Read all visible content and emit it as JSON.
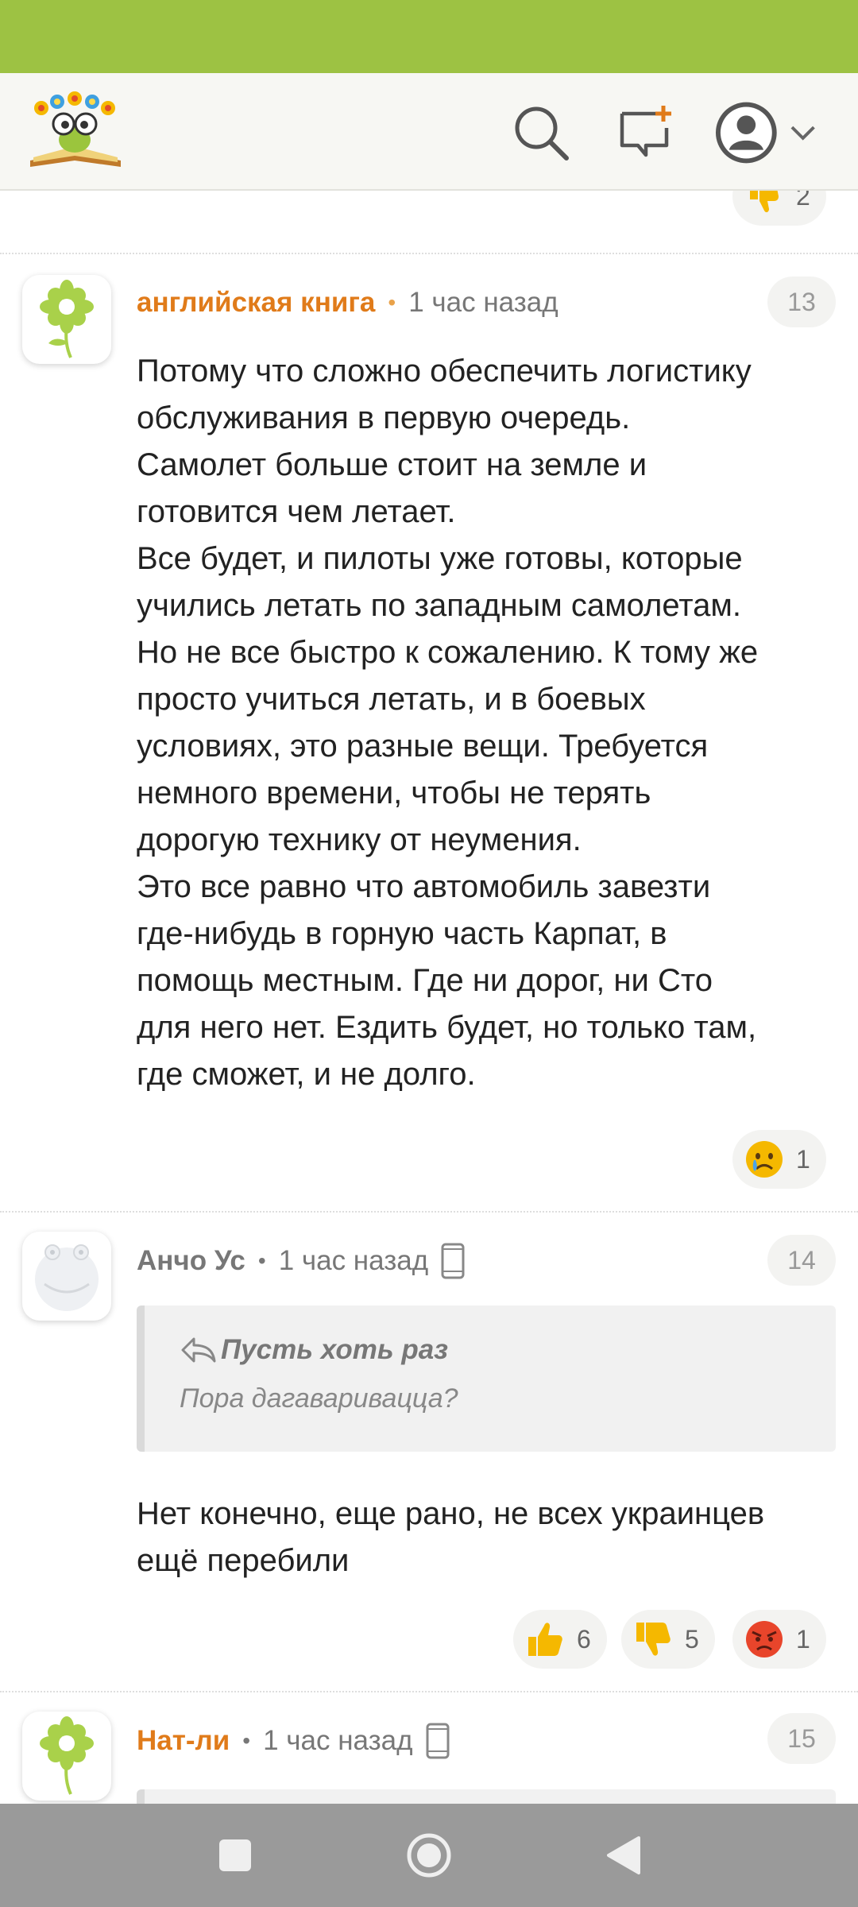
{
  "header": {
    "logo_icon": "book-daisy-logo-icon",
    "search_icon": "search-icon",
    "new_message_icon": "new-message-icon",
    "profile_icon": "profile-avatar-icon",
    "menu_icon": "chevron-down-icon"
  },
  "top_reaction": {
    "emoji": "thumbs-down-icon",
    "count": "2"
  },
  "comments": [
    {
      "author": "английская книга",
      "time": "1 час назад",
      "number": "13",
      "avatar_icon": "flower-avatar-icon",
      "text": [
        "Потому что сложно обеспечить логистику",
        "обслуживания в первую очередь.",
        "Самолет больше стоит на земле и",
        "готовится чем летает.",
        "Все будет, и пилоты уже готовы, которые",
        "учились летать по западным самолетам.",
        "Но не все быстро к сожалению. К тому же",
        "просто учиться летать, и в боевых",
        "условиях, это разные вещи. Требуется",
        "немного времени, чтобы не терять",
        "дорогую технику от неумения.",
        "Это все равно что автомобиль завезти",
        "где-нибудь в горную часть Карпат, в",
        "помощь местным. Где ни дорог, ни Сто",
        "для него нет. Ездить будет, но только там,",
        "где сможет, и не долго."
      ],
      "reactions": [
        {
          "emoji": "crying-face-icon",
          "count": "1"
        }
      ]
    },
    {
      "author": "Анчо Ус",
      "time": "1 час назад",
      "number": "14",
      "avatar_icon": "ghost-avatar-icon",
      "device_icon": "mobile-device-icon",
      "quote": {
        "title": "Пусть хоть раз",
        "text": "Пора дагаваривацца?"
      },
      "text": [
        "Нет конечно, еще рано, не всех украинцев",
        "ещё перебили"
      ],
      "reactions": [
        {
          "emoji": "thumbs-up-icon",
          "count": "6"
        },
        {
          "emoji": "thumbs-down-icon",
          "count": "5"
        },
        {
          "emoji": "angry-face-icon",
          "count": "1"
        }
      ]
    },
    {
      "author": "Нат-ли",
      "time": "1 час назад",
      "number": "15",
      "avatar_icon": "flower-avatar-icon",
      "device_icon": "mobile-device-icon"
    }
  ],
  "colors": {
    "status_bar": "#9dc243",
    "accent_orange": "#e07b1a",
    "nav_bar": "#9a9a9a"
  }
}
